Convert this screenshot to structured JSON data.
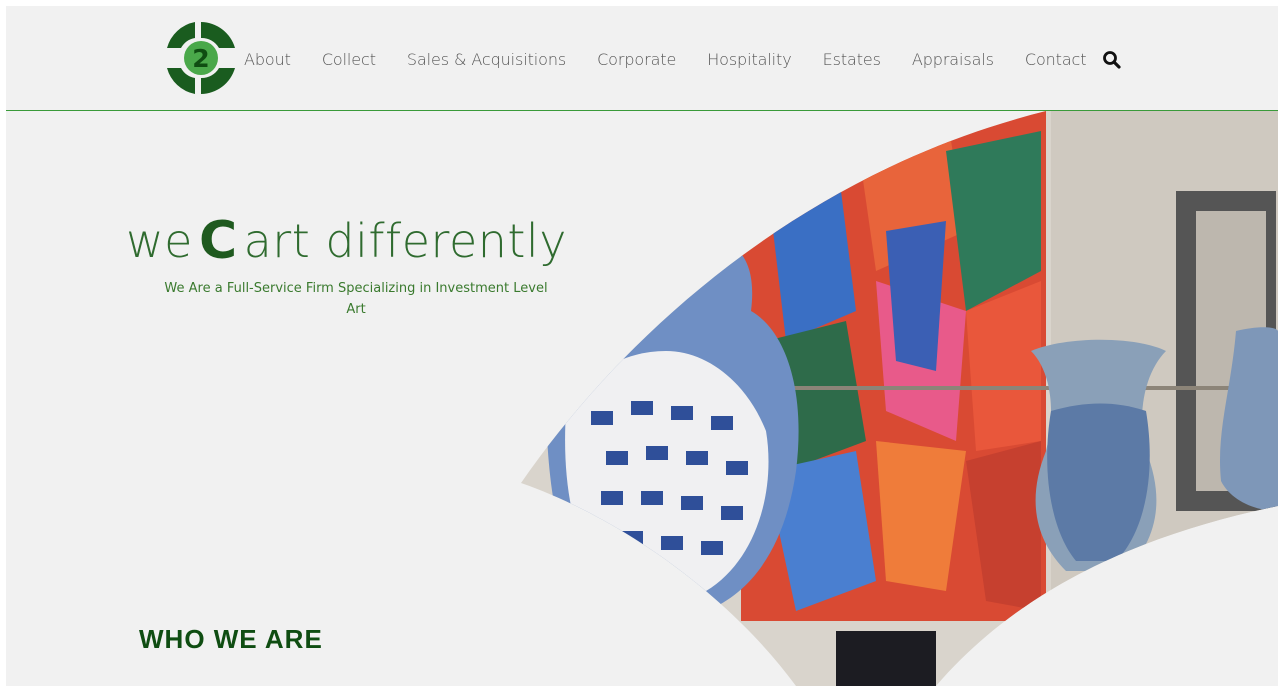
{
  "brand": {
    "logo_char": "2",
    "primary_color": "#0f4d12",
    "accent_color": "#4aa84a"
  },
  "nav": {
    "items": [
      {
        "label": "About"
      },
      {
        "label": "Collect"
      },
      {
        "label": "Sales & Acquisitions"
      },
      {
        "label": "Corporate"
      },
      {
        "label": "Hospitality"
      },
      {
        "label": "Estates"
      },
      {
        "label": "Appraisals"
      },
      {
        "label": "Contact"
      }
    ],
    "search_icon": "search-icon"
  },
  "hero": {
    "tagline_prefix": "we",
    "tagline_mark": "C",
    "tagline_suffix": "art differently",
    "subtitle": "We Are a Full-Service Firm Specializing in Investment Level Art",
    "image_subject": "abstract painting with blue and white vases"
  },
  "section": {
    "heading": "WHO WE ARE"
  }
}
